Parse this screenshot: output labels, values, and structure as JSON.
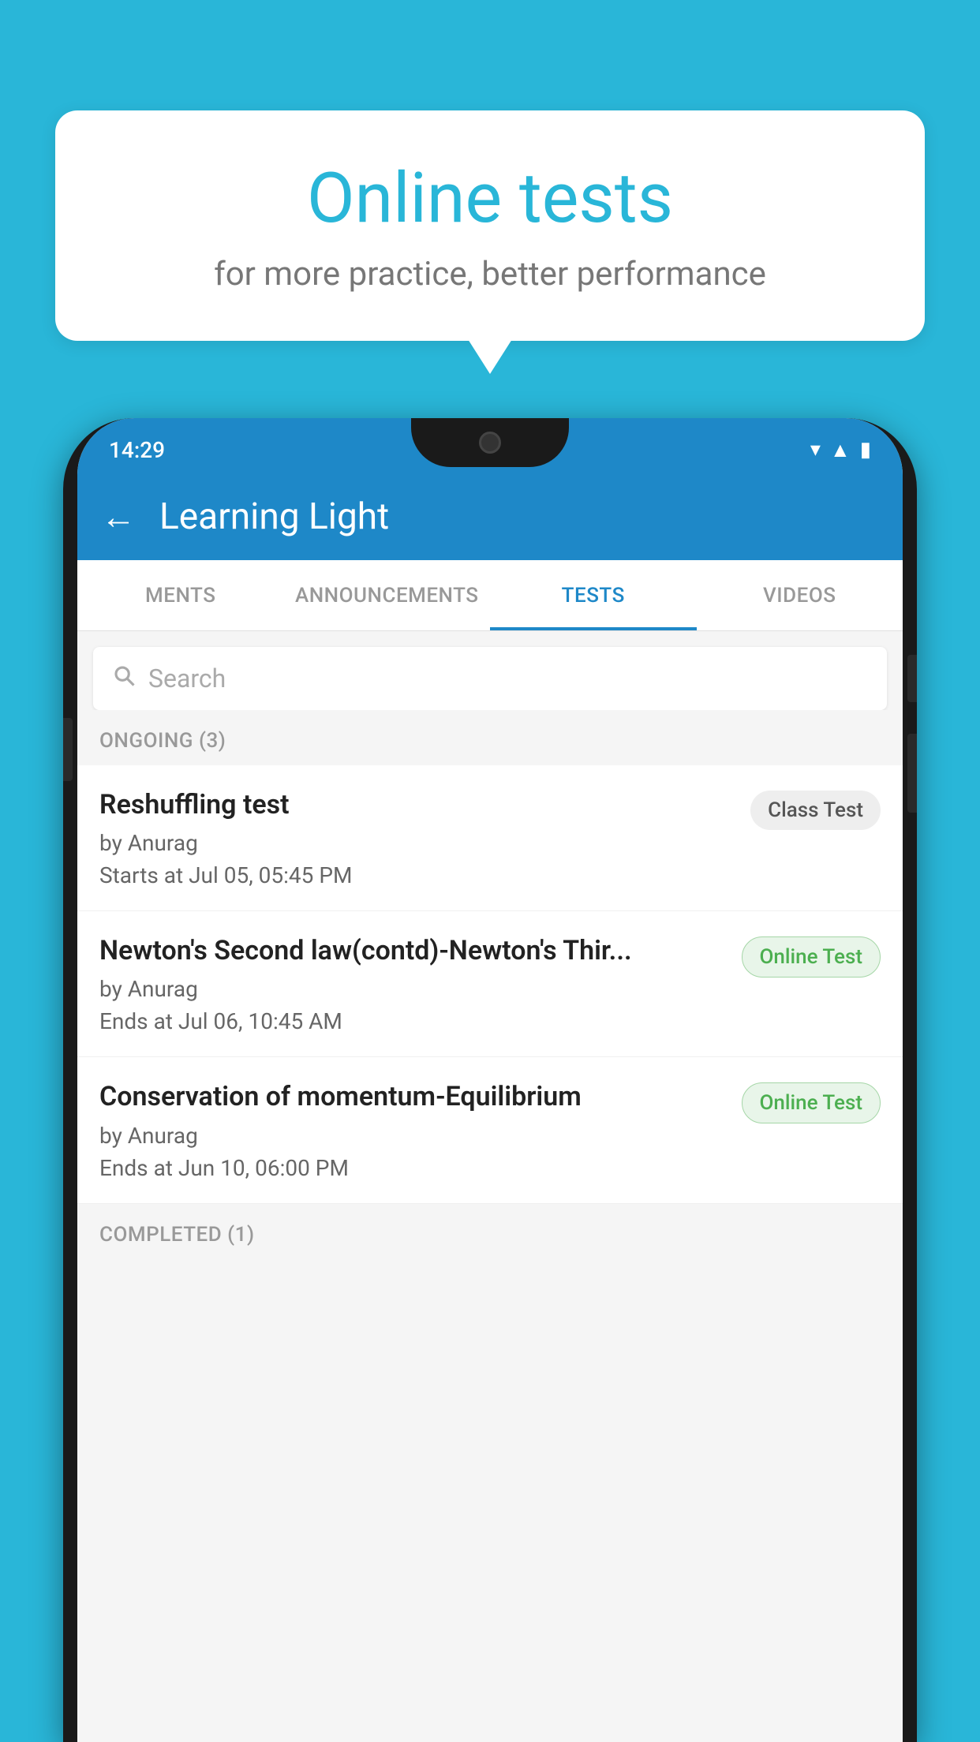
{
  "background": {
    "color": "#29b6d8"
  },
  "speech_bubble": {
    "title": "Online tests",
    "subtitle": "for more practice, better performance"
  },
  "phone": {
    "status_bar": {
      "time": "14:29",
      "wifi": "▾",
      "signal": "▾",
      "battery": "▮"
    },
    "app_bar": {
      "back_label": "←",
      "title": "Learning Light"
    },
    "tabs": [
      {
        "label": "MENTS",
        "active": false
      },
      {
        "label": "ANNOUNCEMENTS",
        "active": false
      },
      {
        "label": "TESTS",
        "active": true
      },
      {
        "label": "VIDEOS",
        "active": false
      }
    ],
    "search": {
      "placeholder": "Search"
    },
    "ongoing_section": {
      "label": "ONGOING (3)"
    },
    "tests": [
      {
        "name": "Reshuffling test",
        "author": "by Anurag",
        "time": "Starts at  Jul 05, 05:45 PM",
        "badge": "Class Test",
        "badge_type": "class"
      },
      {
        "name": "Newton's Second law(contd)-Newton's Thir...",
        "author": "by Anurag",
        "time": "Ends at  Jul 06, 10:45 AM",
        "badge": "Online Test",
        "badge_type": "online"
      },
      {
        "name": "Conservation of momentum-Equilibrium",
        "author": "by Anurag",
        "time": "Ends at  Jun 10, 06:00 PM",
        "badge": "Online Test",
        "badge_type": "online"
      }
    ],
    "completed_section": {
      "label": "COMPLETED (1)"
    }
  }
}
